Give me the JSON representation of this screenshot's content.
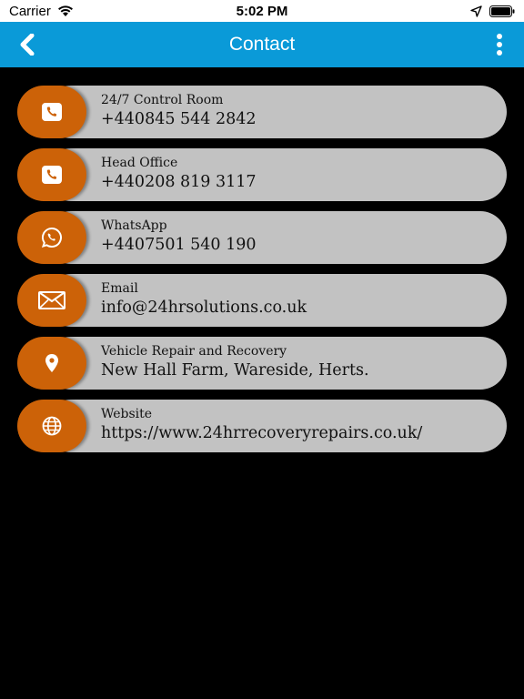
{
  "status_bar": {
    "carrier": "Carrier",
    "time": "5:02 PM"
  },
  "nav": {
    "title": "Contact",
    "back_icon": "chevron-left-icon",
    "menu_icon": "more-vertical-icon",
    "color": "#0a9ad8"
  },
  "theme": {
    "accent": "#cc6208",
    "pill": "#c2c2c2",
    "background": "#000000"
  },
  "contacts": [
    {
      "label": "24/7 Control Room",
      "value": "+440845 544 2842",
      "icon": "phone-icon"
    },
    {
      "label": "Head Office",
      "value": "+440208 819 3117",
      "icon": "phone-icon"
    },
    {
      "label": "WhatsApp",
      "value": "+4407501 540 190",
      "icon": "whatsapp-icon"
    },
    {
      "label": "Email",
      "value": "info@24hrsolutions.co.uk",
      "icon": "mail-icon"
    },
    {
      "label": "Vehicle Repair and Recovery",
      "value": "New Hall Farm, Wareside, Herts.",
      "icon": "location-pin-icon"
    },
    {
      "label": "Website",
      "value": "https://www.24hrrecoveryrepairs.co.uk/",
      "icon": "globe-icon"
    }
  ]
}
